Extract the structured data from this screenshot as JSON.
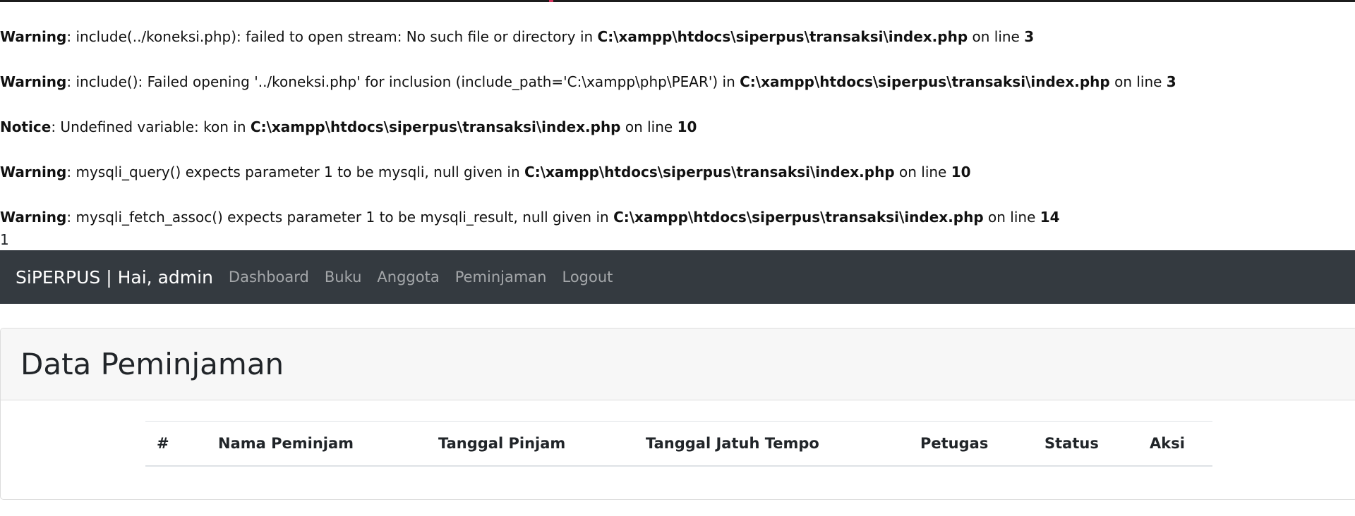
{
  "errors": [
    {
      "level": "Warning",
      "message": ": include(../koneksi.php): failed to open stream: No such file or directory in ",
      "file": "C:\\xampp\\htdocs\\siperpus\\transaksi\\index.php",
      "on_line": " on line ",
      "line": "3"
    },
    {
      "level": "Warning",
      "message": ": include(): Failed opening '../koneksi.php' for inclusion (include_path='C:\\xampp\\php\\PEAR') in ",
      "file": "C:\\xampp\\htdocs\\siperpus\\transaksi\\index.php",
      "on_line": " on line ",
      "line": "3"
    },
    {
      "level": "Notice",
      "message": ": Undefined variable: kon in ",
      "file": "C:\\xampp\\htdocs\\siperpus\\transaksi\\index.php",
      "on_line": " on line ",
      "line": "10"
    },
    {
      "level": "Warning",
      "message": ": mysqli_query() expects parameter 1 to be mysqli, null given in ",
      "file": "C:\\xampp\\htdocs\\siperpus\\transaksi\\index.php",
      "on_line": " on line ",
      "line": "10"
    },
    {
      "level": "Warning",
      "message": ": mysqli_fetch_assoc() expects parameter 1 to be mysqli_result, null given in ",
      "file": "C:\\xampp\\htdocs\\siperpus\\transaksi\\index.php",
      "on_line": " on line ",
      "line": "14"
    }
  ],
  "stray_output": "1",
  "navbar": {
    "brand": "SiPERPUS | Hai, admin",
    "links": [
      "Dashboard",
      "Buku",
      "Anggota",
      "Peminjaman",
      "Logout"
    ]
  },
  "card": {
    "title": "Data Peminjaman",
    "table": {
      "headers": [
        "#",
        "Nama Peminjam",
        "Tanggal Pinjam",
        "Tanggal Jatuh Tempo",
        "Petugas",
        "Status",
        "Aksi"
      ],
      "rows": []
    }
  },
  "colors": {
    "navbar_bg": "#343a40",
    "card_header_bg": "#f7f7f7"
  }
}
